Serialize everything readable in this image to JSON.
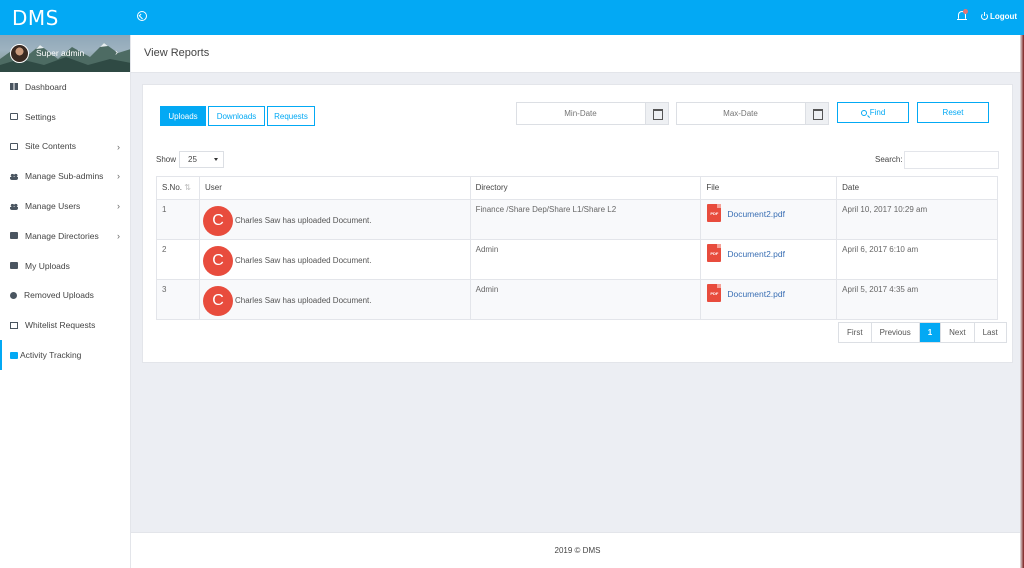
{
  "app": {
    "brand": "DMS"
  },
  "topbar": {
    "logout_label": "Logout"
  },
  "profile": {
    "name": "Super admin"
  },
  "sidebar": {
    "items": [
      {
        "label": "Dashboard",
        "icon": "dashboard-icon",
        "chevron": false
      },
      {
        "label": "Settings",
        "icon": "settings-icon",
        "chevron": false
      },
      {
        "label": "Site Contents",
        "icon": "site-contents-icon",
        "chevron": true
      },
      {
        "label": "Manage Sub-admins",
        "icon": "users-icon",
        "chevron": true
      },
      {
        "label": "Manage Users",
        "icon": "users-icon",
        "chevron": true
      },
      {
        "label": "Manage Directories",
        "icon": "folder-icon",
        "chevron": true
      },
      {
        "label": "My Uploads",
        "icon": "folder-icon",
        "chevron": false
      },
      {
        "label": "Removed Uploads",
        "icon": "minus-circle-icon",
        "chevron": false
      },
      {
        "label": "Whitelist Requests",
        "icon": "checkbox-icon",
        "chevron": false
      },
      {
        "label": "Activity Tracking",
        "icon": "activity-icon",
        "chevron": false,
        "active": true
      }
    ]
  },
  "page": {
    "title": "View Reports"
  },
  "tabs": {
    "uploads": "Uploads",
    "downloads": "Downloads",
    "requests": "Requests"
  },
  "filters": {
    "min_date_placeholder": "Min-Date",
    "max_date_placeholder": "Max-Date",
    "find_label": "Find",
    "reset_label": "Reset"
  },
  "table_controls": {
    "show_label": "Show",
    "page_size": "25",
    "search_label": "Search:"
  },
  "table": {
    "headers": {
      "sno": "S.No.",
      "user": "User",
      "directory": "Directory",
      "file": "File",
      "date": "Date"
    },
    "rows": [
      {
        "sno": "1",
        "avatar": "C",
        "user_text": "Charles Saw has uploaded Document.",
        "directory": "Finance /Share Dep/Share L1/Share L2",
        "file": "Document2.pdf",
        "date": "April 10, 2017 10:29 am"
      },
      {
        "sno": "2",
        "avatar": "C",
        "user_text": "Charles Saw has uploaded Document.",
        "directory": "Admin",
        "file": "Document2.pdf",
        "date": "April 6, 2017 6:10 am"
      },
      {
        "sno": "3",
        "avatar": "C",
        "user_text": "Charles Saw has uploaded Document.",
        "directory": "Admin",
        "file": "Document2.pdf",
        "date": "April 5, 2017 4:35 am"
      }
    ]
  },
  "pagination": {
    "first": "First",
    "previous": "Previous",
    "current": "1",
    "next": "Next",
    "last": "Last"
  },
  "footer": {
    "text": "2019 © DMS"
  },
  "colors": {
    "accent": "#03a9f4",
    "avatar": "#e84c3d",
    "link": "#3a6fb4"
  }
}
